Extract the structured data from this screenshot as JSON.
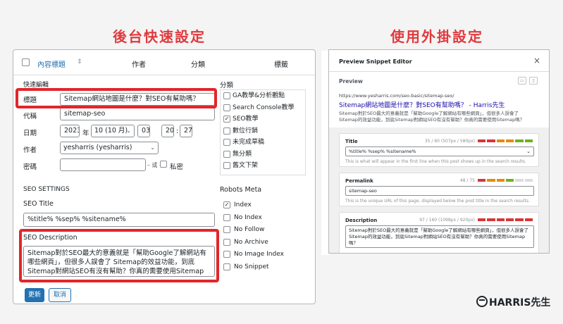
{
  "headings": {
    "left": "後台快速設定",
    "right": "使用外掛設定"
  },
  "table_header": {
    "title": "內容標題",
    "sort_icon": "⇕",
    "author": "作者",
    "category": "分類",
    "tags": "標籤"
  },
  "quick_edit": {
    "section_label": "快速編輯",
    "title_label": "標題",
    "title_value": "Sitemap網站地圖是什麼？對SEO有幫助嗎？",
    "slug_label": "代稱",
    "slug_value": "sitemap-seo",
    "date_label": "日期",
    "year": "2023",
    "year_suffix": "年",
    "month": "10 (10 月)",
    "day": "03",
    "hour": "20",
    "minute": "27",
    "time_sep": ":",
    "author_label": "作者",
    "author_value": "yesharris (yesharris)",
    "password_label": "密碼",
    "or_text": "– 或 –",
    "private_label": "私密"
  },
  "categories": {
    "label": "分類",
    "items": [
      {
        "label": "GA教學&分析觀點",
        "checked": false
      },
      {
        "label": "Search Console教學",
        "checked": false
      },
      {
        "label": "SEO教學",
        "checked": true
      },
      {
        "label": "數位行銷",
        "checked": false
      },
      {
        "label": "未完成草稿",
        "checked": false
      },
      {
        "label": "無分類",
        "checked": false
      },
      {
        "label": "舊文下架",
        "checked": false
      }
    ]
  },
  "seo": {
    "section_label": "SEO SETTINGS",
    "title_label": "SEO Title",
    "title_value": "%title% %sep% %sitename%",
    "desc_label": "SEO Description",
    "desc_value": "Sitemap對於SEO最大的意義就是「幫助Google了解網站有哪些網頁」，但很多人誤會了 Sitemap的效益功能，到底Sitemap對網站SEO有沒有幫助？你真的需要使用Sitemap嗎？"
  },
  "robots": {
    "label": "Robots Meta",
    "items": [
      {
        "label": "Index",
        "checked": true
      },
      {
        "label": "No Index",
        "checked": false
      },
      {
        "label": "No Follow",
        "checked": false
      },
      {
        "label": "No Archive",
        "checked": false
      },
      {
        "label": "No Image Index",
        "checked": false
      },
      {
        "label": "No Snippet",
        "checked": false
      }
    ]
  },
  "buttons": {
    "update": "更新",
    "cancel": "取消"
  },
  "editor": {
    "title": "Preview Snippet Editor",
    "close_icon": "×",
    "preview_label": "Preview",
    "url": "https://www.yesharris.com/seo-basic/sitemap-seo/",
    "link_title": "Sitemap網站地圖是什麼？對SEO有幫助嗎？ - Harris先生",
    "snippet": "Sitemap對於SEO最大的意義就是「幫助Google了解網站有哪些網頁」，但很多人誤會了Sitemap的效益功能，到底Sitemap對網站SEO有沒有幫助？你真的需要使用Sitemap嗎？",
    "title_field": {
      "label": "Title",
      "count": "35 / 60 (507px / 580px)",
      "value": "%title% %sep% %sitename%",
      "hint": "This is what will appear in the first line when this post shows up in the search results."
    },
    "permalink_field": {
      "label": "Permalink",
      "count": "48 / 75",
      "value": "sitemap-seo",
      "hint": "This is the unique URL of this page, displayed below the post title in the search results."
    },
    "description_field": {
      "label": "Description",
      "count": "97 / 160 (1098px / 920px)",
      "value": "Sitemap對於SEO最大的意義就是「幫助Google了解網站有哪些網頁」，但很多人誤會了Sitemap的效益功能，到底Sitemap對網站SEO有沒有幫助？你真的需要使用Sitemap嗎？"
    },
    "colors": {
      "red": "#d63638",
      "orange": "#e68a00",
      "green": "#6fb21d",
      "gray": "#dcdcde"
    }
  },
  "logo": {
    "text": "HARRIS先生"
  }
}
